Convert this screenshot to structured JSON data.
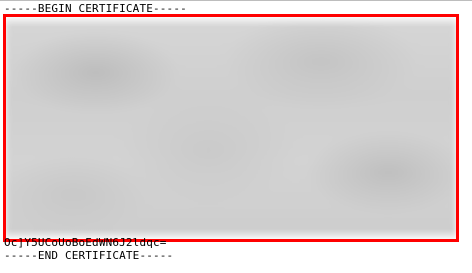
{
  "certificate": {
    "begin_marker": "-----BEGIN CERTIFICATE-----",
    "visible_tail": "Oc]Y5UCoUoBoEdWN6J2ldqc=",
    "end_marker": "-----END CERTIFICATE-----"
  },
  "colors": {
    "highlight_border": "#ff0000",
    "redaction_fill": "#cfcfcf",
    "text": "#000000",
    "background": "#ffffff"
  }
}
